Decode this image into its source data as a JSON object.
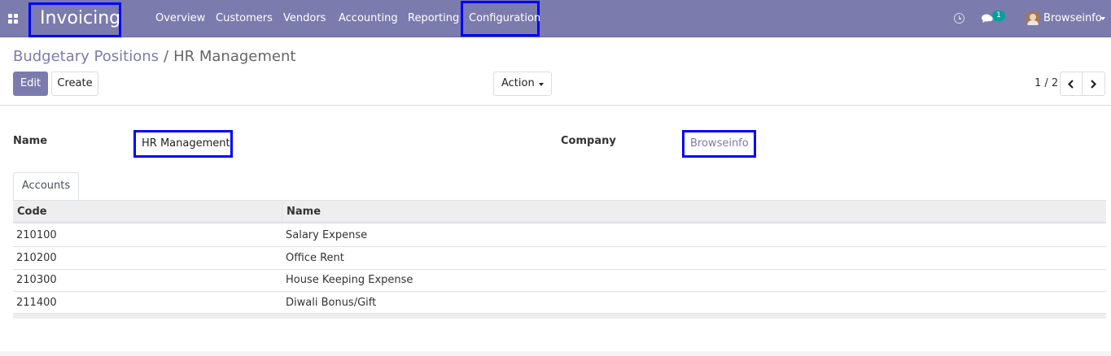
{
  "navbar": {
    "app_title": "Invoicing",
    "menu": [
      "Overview",
      "Customers",
      "Vendors",
      "Accounting",
      "Reporting",
      "Configuration"
    ],
    "notification_count": "1",
    "user_name": "Browseinfo",
    "colors": {
      "bar": "#7c7bad",
      "highlight_box": "#0000ff",
      "badge": "#00a09d"
    }
  },
  "breadcrumb": {
    "parent": "Budgetary Positions",
    "separator": "/",
    "current": "HR Management"
  },
  "buttons": {
    "edit": "Edit",
    "create": "Create",
    "action": "Action"
  },
  "pager": {
    "value": "1 / 2"
  },
  "form": {
    "name_label": "Name",
    "name_value": "HR Management",
    "company_label": "Company",
    "company_value": "Browseinfo"
  },
  "tabs": [
    "Accounts"
  ],
  "accounts_table": {
    "columns": [
      "Code",
      "Name"
    ],
    "rows": [
      {
        "code": "210100",
        "name": "Salary Expense"
      },
      {
        "code": "210200",
        "name": "Office Rent"
      },
      {
        "code": "210300",
        "name": "House Keeping Expense"
      },
      {
        "code": "211400",
        "name": "Diwali Bonus/Gift"
      }
    ]
  }
}
